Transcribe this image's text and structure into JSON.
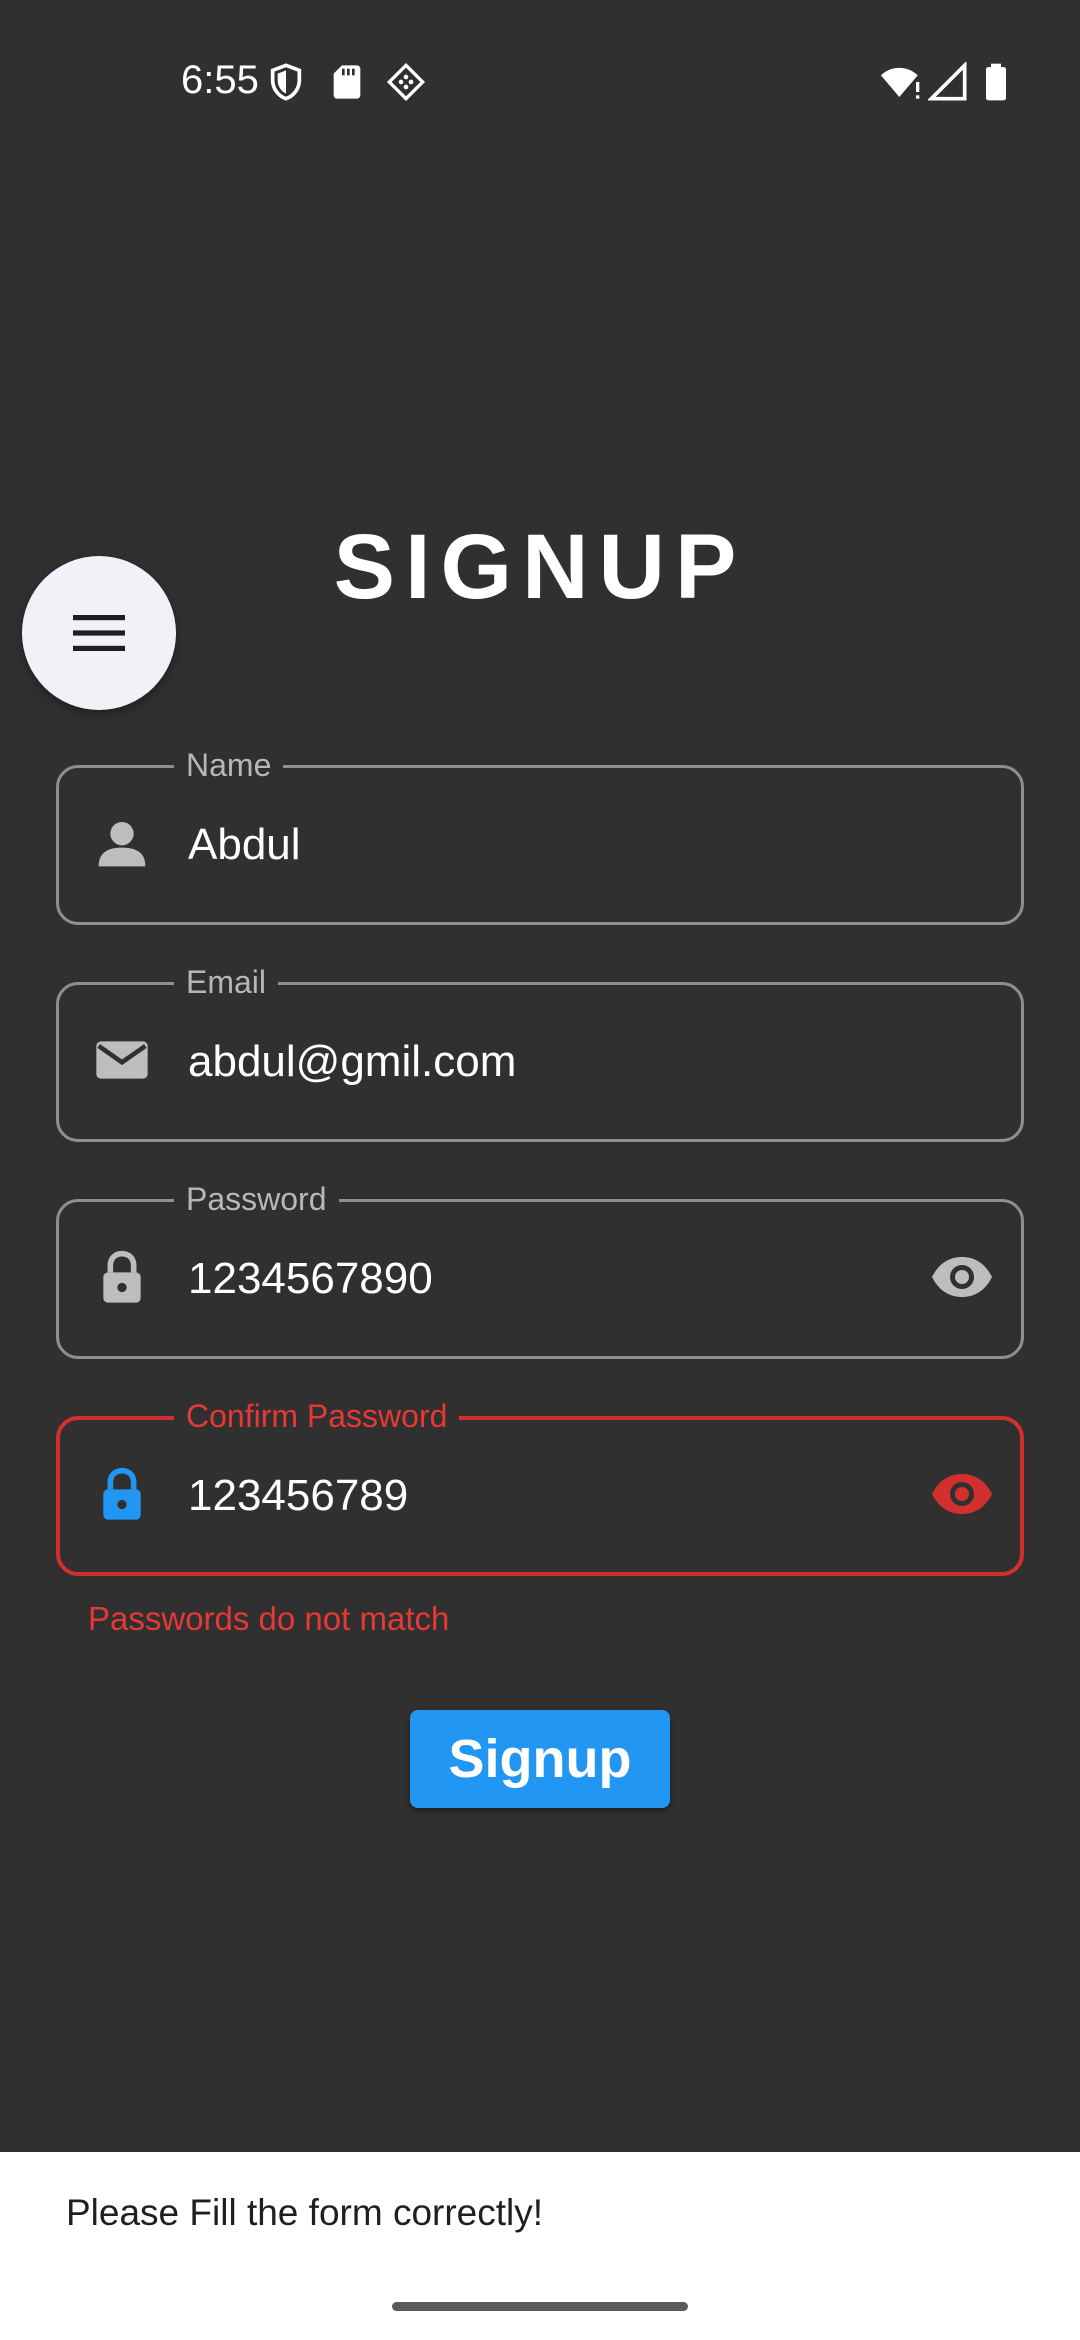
{
  "status_bar": {
    "time": "6:55",
    "icons_left": [
      "shield-icon",
      "sd-card-icon",
      "debug-diamond-icon"
    ],
    "icons_right": [
      "wifi-icon",
      "cell-signal-icon",
      "battery-icon"
    ]
  },
  "page": {
    "title": "SIGNUP",
    "menu_icon": "hamburger-menu-icon"
  },
  "form": {
    "name": {
      "label": "Name",
      "value": "Abdul",
      "icon": "person-icon"
    },
    "email": {
      "label": "Email",
      "value": "abdul@gmil.com",
      "icon": "mail-icon"
    },
    "password": {
      "label": "Password",
      "value": "1234567890",
      "icon": "lock-icon",
      "toggle_icon": "eye-icon"
    },
    "confirm_password": {
      "label": "Confirm Password",
      "value": "123456789",
      "icon": "lock-icon",
      "toggle_icon": "eye-icon",
      "error": "Passwords do not match"
    },
    "submit_label": "Signup"
  },
  "snackbar": {
    "message": "Please Fill the form correctly!"
  },
  "colors": {
    "background": "#303030",
    "accent": "#2196f3",
    "error": "#d32f2f",
    "outline": "#8f8f8f",
    "fab": "#f2f1f8"
  }
}
